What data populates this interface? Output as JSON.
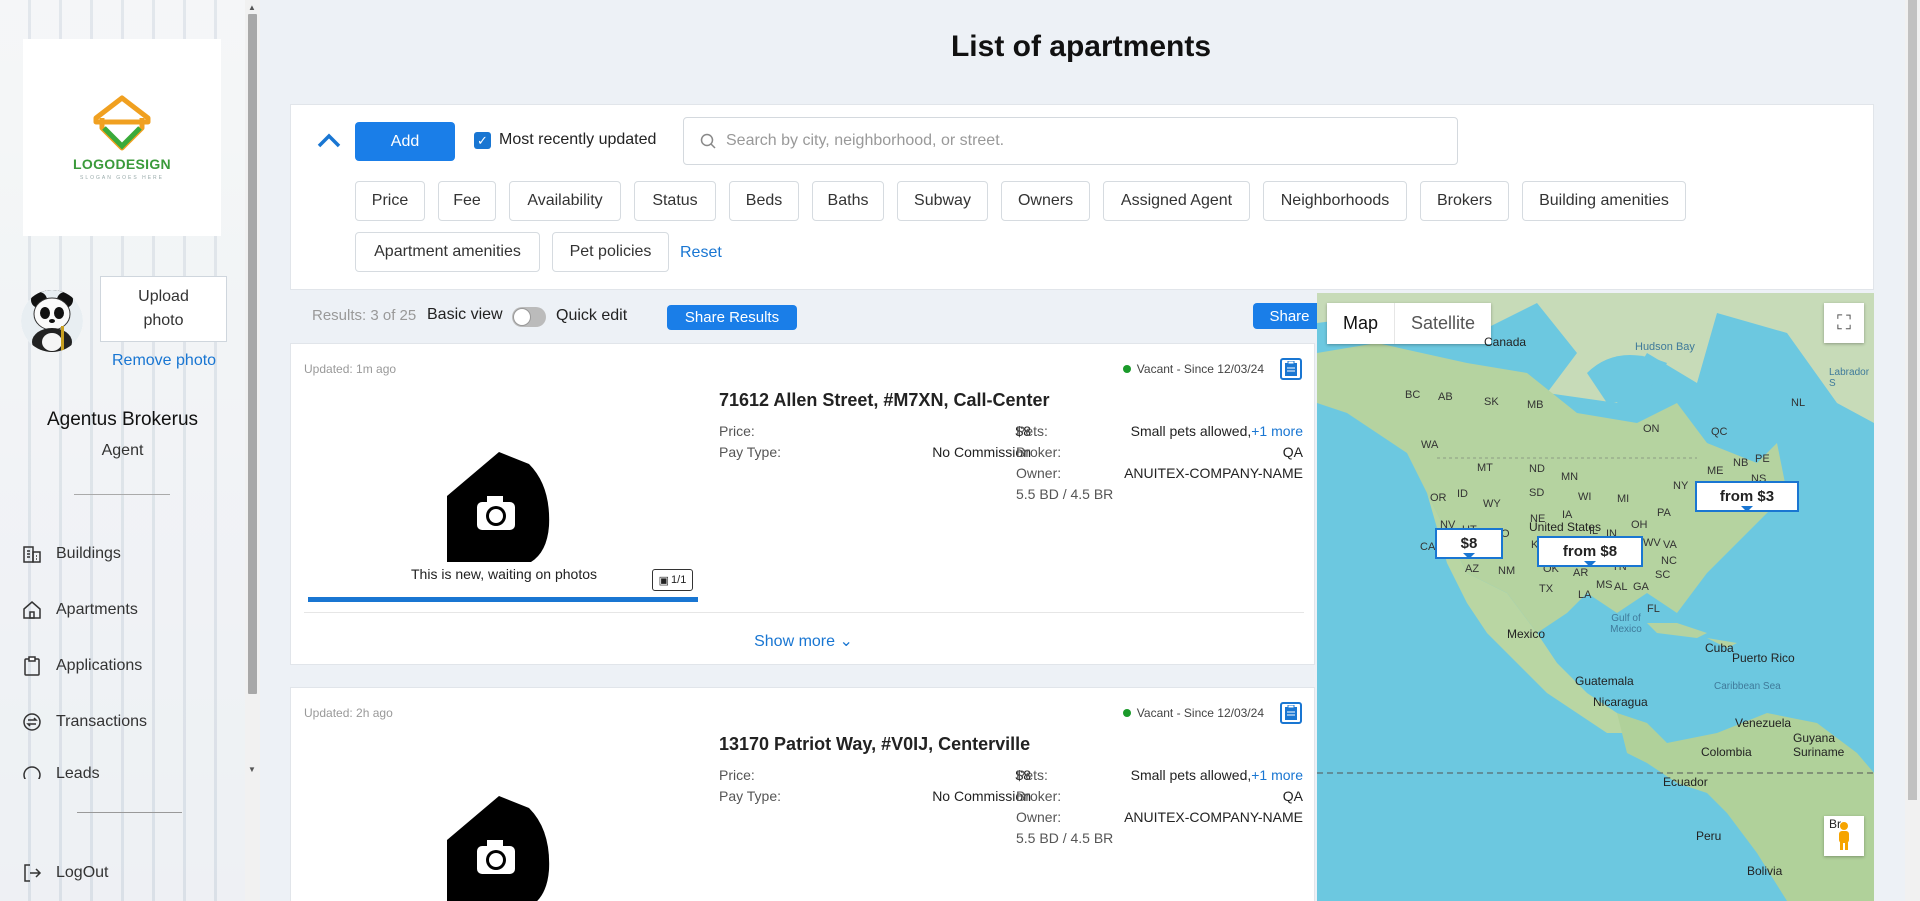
{
  "sidebar": {
    "logo_text": "LOGODESIGN",
    "logo_sub": "SLOGAN GOES HERE",
    "upload_label": "Upload photo",
    "remove_photo": "Remove photo",
    "agent_name": "Agentus Brokerus",
    "agent_role": "Agent",
    "nav": [
      {
        "label": "Buildings",
        "icon": "building-icon"
      },
      {
        "label": "Apartments",
        "icon": "home-icon"
      },
      {
        "label": "Applications",
        "icon": "clipboard-icon"
      },
      {
        "label": "Transactions",
        "icon": "exchange-icon"
      },
      {
        "label": "Leads",
        "icon": "leads-icon"
      }
    ],
    "logout": "LogOut"
  },
  "page": {
    "title": "List of apartments"
  },
  "filters": {
    "add_label": "Add",
    "recent_label": "Most recently updated",
    "recent_checked": true,
    "search_placeholder": "Search by city, neighborhood, or street.",
    "chips": [
      "Price",
      "Fee",
      "Availability",
      "Status",
      "Beds",
      "Baths",
      "Subway",
      "Owners",
      "Assigned Agent",
      "Neighborhoods",
      "Brokers",
      "Building amenities",
      "Apartment amenities",
      "Pet policies"
    ],
    "reset": "Reset"
  },
  "results": {
    "count_text": "Results: 3 of 25",
    "basic_view": "Basic view",
    "quick_edit": "Quick edit",
    "share_results": "Share Results",
    "share": "Share"
  },
  "listings": [
    {
      "updated": "Updated: 1m ago",
      "status": "Vacant - Since 12/03/24",
      "address": "71612 Allen Street, #M7XN, Call-Center",
      "price_label": "Price:",
      "price": "$8",
      "paytype_label": "Pay Type:",
      "paytype": "No Commission",
      "pets_label": "Pets:",
      "pets": "Small pets allowed,",
      "pets_more": "+1 more",
      "broker_label": "Broker:",
      "broker": "QA",
      "owner_label": "Owner:",
      "owner": "ANUITEX-COMPANY-NAME",
      "rooms": "5.5 BD / 4.5 BR",
      "photo_caption": "This is new, waiting on photos",
      "photo_count": "1/1",
      "show_more": "Show more"
    },
    {
      "updated": "Updated: 2h ago",
      "status": "Vacant - Since 12/03/24",
      "address": "13170 Patriot Way, #V0IJ, Centerville",
      "price_label": "Price:",
      "price": "$8",
      "paytype_label": "Pay Type:",
      "paytype": "No Commission",
      "pets_label": "Pets:",
      "pets": "Small pets allowed,",
      "pets_more": "+1 more",
      "broker_label": "Broker:",
      "broker": "QA",
      "owner_label": "Owner:",
      "owner": "ANUITEX-COMPANY-NAME",
      "rooms": "5.5 BD / 4.5 BR"
    }
  ],
  "map": {
    "tab_map": "Map",
    "tab_satellite": "Satellite",
    "markers": [
      "$8",
      "from $8",
      "from $3"
    ],
    "labels": [
      "Canada",
      "Hudson Bay",
      "Labrador S",
      "United States",
      "Mexico",
      "Gulf of Mexico",
      "Cuba",
      "Puerto Rico",
      "Caribbean Sea",
      "Guatemala",
      "Nicaragua",
      "Venezuela",
      "Guyana",
      "Suriname",
      "Colombia",
      "Ecuador",
      "Peru",
      "Bolivia",
      "Br"
    ],
    "state_labels": [
      "BC",
      "AB",
      "SK",
      "MB",
      "ON",
      "QC",
      "NL",
      "WA",
      "MT",
      "ND",
      "MN",
      "OR",
      "ID",
      "WY",
      "SD",
      "WI",
      "MI",
      "NY",
      "NV",
      "UT",
      "CO",
      "NE",
      "IA",
      "IL",
      "IN",
      "OH",
      "PA",
      "CA",
      "KS",
      "MO",
      "KY",
      "WV",
      "VA",
      "AZ",
      "NM",
      "OK",
      "AR",
      "TN",
      "NC",
      "SC",
      "TX",
      "LA",
      "MS",
      "AL",
      "GA",
      "FL",
      "ME",
      "NB",
      "NS",
      "PE"
    ]
  }
}
